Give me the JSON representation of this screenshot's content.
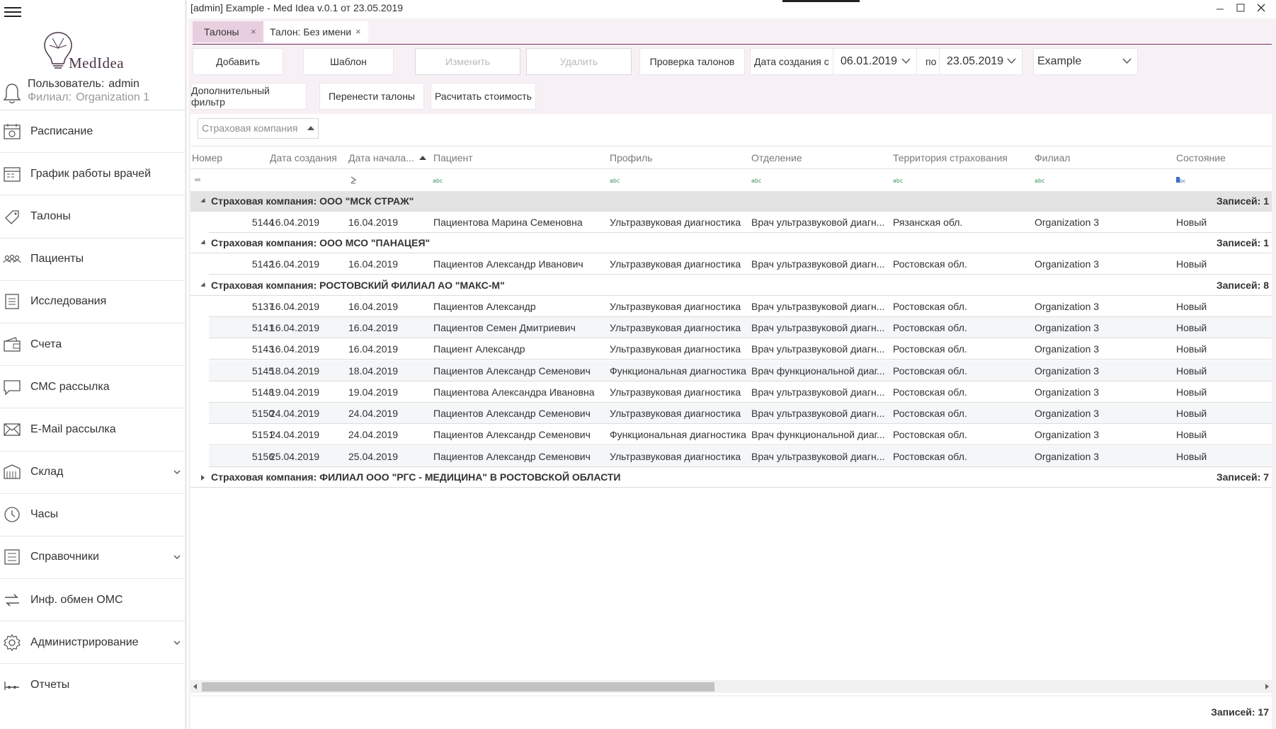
{
  "window": {
    "title": "[admin] Example - Med Idea v.0.1 от 23.05.2019"
  },
  "sidebar": {
    "logo_text": "MedIdea",
    "user_label": "Пользователь:",
    "user_value": "admin",
    "branch_label": "Филиал:",
    "branch_value": "Organization 1",
    "items": [
      {
        "label": "Расписание",
        "icon": "calendar-icon"
      },
      {
        "label": "График работы врачей",
        "icon": "schedule-icon"
      },
      {
        "label": "Талоны",
        "icon": "ticket-icon"
      },
      {
        "label": "Пациенты",
        "icon": "patients-icon"
      },
      {
        "label": "Исследования",
        "icon": "research-icon"
      },
      {
        "label": "Счета",
        "icon": "wallet-icon"
      },
      {
        "label": "СМС рассылка",
        "icon": "sms-icon"
      },
      {
        "label": "E-Mail рассылка",
        "icon": "email-icon"
      },
      {
        "label": "Склад",
        "icon": "warehouse-icon",
        "expandable": true
      },
      {
        "label": "Часы",
        "icon": "clock-icon"
      },
      {
        "label": "Справочники",
        "icon": "reference-icon",
        "expandable": true
      },
      {
        "label": "Инф. обмен ОМС",
        "icon": "exchange-icon"
      },
      {
        "label": "Администрирование",
        "icon": "gear-icon",
        "expandable": true
      },
      {
        "label": "Отчеты",
        "icon": "reports-icon"
      }
    ]
  },
  "tabs": [
    {
      "label": "Талоны",
      "active": true
    },
    {
      "label": "Талон: Без имени",
      "active": false
    }
  ],
  "toolbar": {
    "add": "Добавить",
    "template": "Шаблон",
    "edit": "Изменить",
    "delete": "Удалить",
    "check": "Проверка талонов",
    "date_from_label": "Дата создания с",
    "date_from": "06.01.2019",
    "date_to_label": "по",
    "date_to": "23.05.2019",
    "org": "Example",
    "extra_filter": "Дополнительный фильтр",
    "move": "Перенести талоны",
    "calc": "Расчитать стоимость"
  },
  "grid": {
    "group_by": "Страховая компания",
    "columns": [
      "Номер",
      "Дата создания",
      "Дата начала...",
      "Пациент",
      "Профиль",
      "Отделение",
      "Территория страхования",
      "Филиал",
      "Состояние"
    ],
    "count_label": "Записей:",
    "groups": [
      {
        "title": "Страховая компания: ООО \"МСК СТРАЖ\"",
        "count": "Записей: 1",
        "expanded": true,
        "rows": [
          [
            "5144",
            "16.04.2019",
            "16.04.2019",
            "Пациентова Марина Семеновна",
            "Ультразвуковая диагностика",
            "Врач ультразвуковой диагн...",
            "Рязанская обл.",
            "Organization 3",
            "Новый"
          ]
        ]
      },
      {
        "title": "Страховая компания: ООО МСО \"ПАНАЦЕЯ\"",
        "count": "Записей: 1",
        "expanded": true,
        "rows": [
          [
            "5142",
            "16.04.2019",
            "16.04.2019",
            "Пациентов Александр Иванович",
            "Ультразвуковая диагностика",
            "Врач ультразвуковой диагн...",
            "Ростовская обл.",
            "Organization 3",
            "Новый"
          ]
        ]
      },
      {
        "title": "Страховая компания: РОСТОВСКИЙ ФИЛИАЛ АО \"МАКС-М\"",
        "count": "Записей: 8",
        "expanded": true,
        "rows": [
          [
            "5137",
            "16.04.2019",
            "16.04.2019",
            "Пациентов Александр",
            "Ультразвуковая диагностика",
            "Врач ультразвуковой диагн...",
            "Ростовская обл.",
            "Organization 3",
            "Новый"
          ],
          [
            "5141",
            "16.04.2019",
            "16.04.2019",
            "Пациентов Семен Дмитриевич",
            "Ультразвуковая диагностика",
            "Врач ультразвуковой диагн...",
            "Ростовская обл.",
            "Organization 3",
            "Новый"
          ],
          [
            "5143",
            "16.04.2019",
            "16.04.2019",
            "Пациент Александр",
            "Ультразвуковая диагностика",
            "Врач ультразвуковой диагн...",
            "Ростовская обл.",
            "Organization 3",
            "Новый"
          ],
          [
            "5145",
            "18.04.2019",
            "18.04.2019",
            "Пациентов Александр Семенович",
            "Функциональная диагностика",
            "Врач функциональной диаг...",
            "Ростовская обл.",
            "Organization 3",
            "Новый"
          ],
          [
            "5148",
            "19.04.2019",
            "19.04.2019",
            "Пациентова Александра Ивановна",
            "Ультразвуковая диагностика",
            "Врач ультразвуковой диагн...",
            "Ростовская обл.",
            "Organization 3",
            "Новый"
          ],
          [
            "5150",
            "24.04.2019",
            "24.04.2019",
            "Пациентов Александр Семенович",
            "Ультразвуковая диагностика",
            "Врач ультразвуковой диагн...",
            "Ростовская обл.",
            "Organization 3",
            "Новый"
          ],
          [
            "5151",
            "24.04.2019",
            "24.04.2019",
            "Пациентов Александр Семенович",
            "Функциональная диагностика",
            "Врач функциональной диаг...",
            "Ростовская обл.",
            "Organization 3",
            "Новый"
          ],
          [
            "5156",
            "25.04.2019",
            "25.04.2019",
            "Пациентов Александр Семенович",
            "Ультразвуковая диагностика",
            "Врач ультразвуковой диагн...",
            "Ростовская обл.",
            "Organization 3",
            "Новый"
          ]
        ]
      },
      {
        "title": "Страховая компания: ФИЛИАЛ ООО \"РГС - МЕДИЦИНА\" В РОСТОВСКОЙ ОБЛАСТИ",
        "count": "Записей: 7",
        "expanded": false,
        "rows": []
      }
    ],
    "total": "Записей: 17"
  },
  "colors": {
    "accent": "#7a2e63",
    "active_tab": "#e8cfe0",
    "content_bg": "#f7f1f5"
  }
}
